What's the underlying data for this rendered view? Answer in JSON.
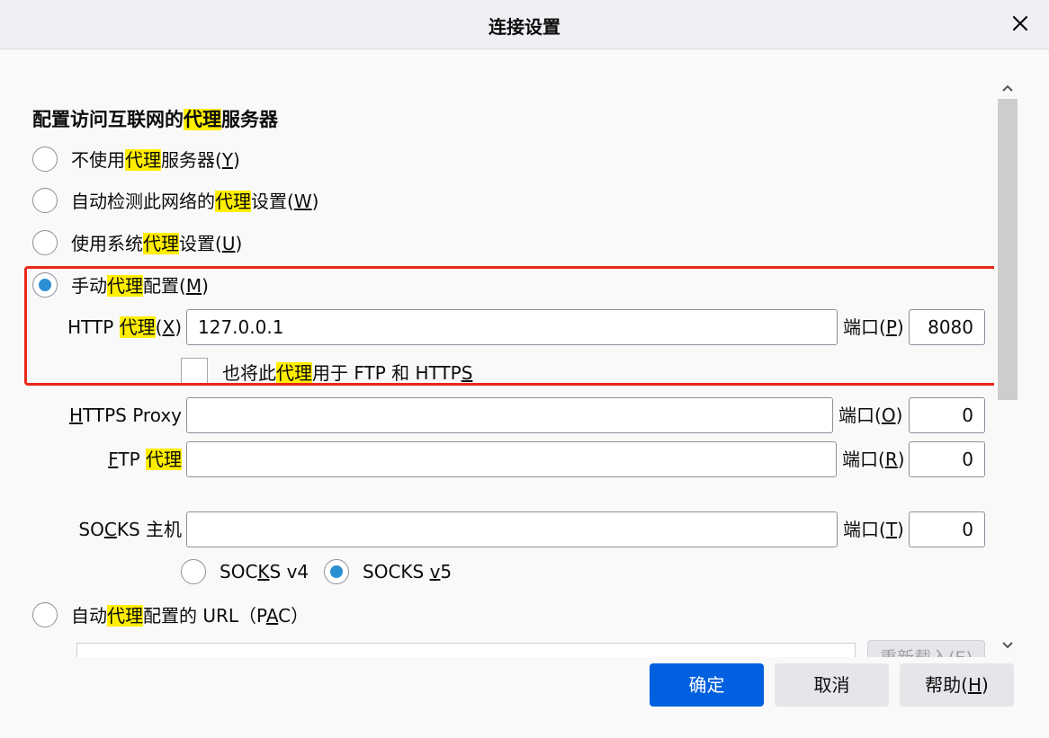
{
  "dialog": {
    "title": "连接设置"
  },
  "section": {
    "heading_pre": "配置访问互联网的",
    "heading_hl": "代理",
    "heading_post": "服务器"
  },
  "options": {
    "no_proxy": {
      "pre": "不使用",
      "hl": "代理",
      "post": "服务器(",
      "key": "Y",
      "end": ")"
    },
    "auto_detect": {
      "pre": "自动检测此网络的",
      "hl": "代理",
      "post": "设置(",
      "key": "W",
      "end": ")"
    },
    "system": {
      "pre": "使用系统",
      "hl": "代理",
      "post": "设置(",
      "key": "U",
      "end": ")"
    },
    "manual": {
      "pre": "手动",
      "hl": "代理",
      "post": "配置(",
      "key": "M",
      "end": ")",
      "checked": true
    },
    "pac": {
      "pre": "自动",
      "hl": "代理",
      "post": "配置的 URL（P",
      "key": "A",
      "end": "C）"
    }
  },
  "http": {
    "label_pre": "HTTP ",
    "label_hl": "代理",
    "label_post": "(",
    "label_key": "X",
    "label_end": ")",
    "value": "127.0.0.1",
    "port_pre": "端口(",
    "port_key": "P",
    "port_end": ")",
    "port_value": "8080",
    "also_pre": "也将此",
    "also_hl": "代理",
    "also_post": "用于 FTP 和 HTTP",
    "also_key": "S",
    "also_checked": false
  },
  "https": {
    "label_key": "H",
    "label_rest": "TTPS Proxy",
    "value": "",
    "port_pre": "端口(",
    "port_key": "O",
    "port_end": ")",
    "port_value": "0"
  },
  "ftp": {
    "label_key": "F",
    "label_rest": "TP ",
    "label_hl": "代理",
    "value": "",
    "port_pre": "端口(",
    "port_key": "R",
    "port_end": ")",
    "port_value": "0"
  },
  "socks": {
    "label_pre": "SO",
    "label_key": "C",
    "label_post": "KS 主机",
    "value": "",
    "port_pre": "端口(",
    "port_key": "T",
    "port_end": ")",
    "port_value": "0",
    "v4_pre": "SOC",
    "v4_key": "K",
    "v4_post": "S v4",
    "v5_pre": "SOCKS ",
    "v5_key": "v",
    "v5_post": "5",
    "v5_checked": true
  },
  "pac": {
    "url": "",
    "reload_label": "重新载入(E)"
  },
  "buttons": {
    "ok": "确定",
    "cancel": "取消",
    "help_pre": "帮助(",
    "help_key": "H",
    "help_end": ")"
  },
  "colors": {
    "highlight": "#ffee00",
    "primary": "#0060df",
    "radio_checked": "#2b8fd3",
    "annotation_box": "#e8281a"
  }
}
